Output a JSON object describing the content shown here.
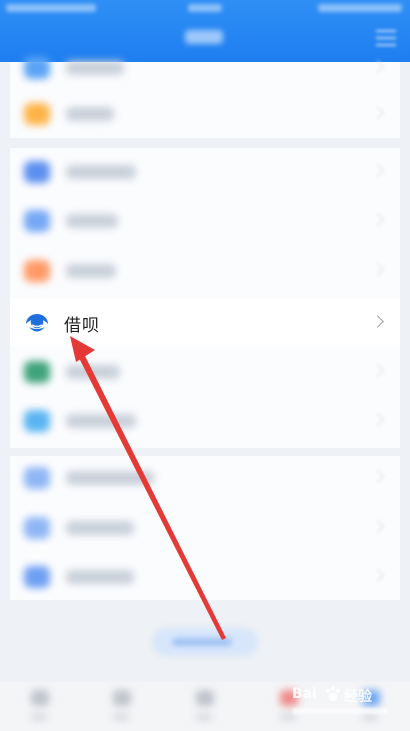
{
  "highlighted_item": {
    "label": "借呗"
  },
  "watermark": {
    "brand_left": "Bai",
    "brand_right": "经验"
  },
  "colors": {
    "header_blue": "#2585f2",
    "annotation_arrow_red": "#e53935",
    "icon_blue": "#1f6fde"
  }
}
